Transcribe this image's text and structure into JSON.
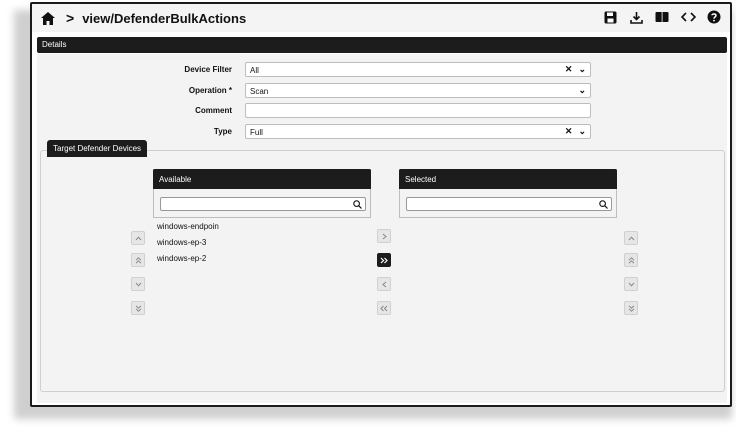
{
  "header": {
    "path_sep": ">",
    "title": "view/DefenderBulkActions"
  },
  "details": {
    "section_title": "Details"
  },
  "form": {
    "device_filter": {
      "label": "Device Filter",
      "value": "All"
    },
    "operation": {
      "label": "Operation *",
      "value": "Scan"
    },
    "comment": {
      "label": "Comment",
      "value": ""
    },
    "type": {
      "label": "Type",
      "value": "Full"
    }
  },
  "target": {
    "tab_label": "Target Defender Devices",
    "available": {
      "title": "Available",
      "items": [
        "windows-endpoin",
        "windows-ep-3",
        "windows-ep-2"
      ]
    },
    "selected": {
      "title": "Selected",
      "items": []
    }
  },
  "glyphs": {
    "clear": "✕",
    "chevron": "⌄"
  }
}
